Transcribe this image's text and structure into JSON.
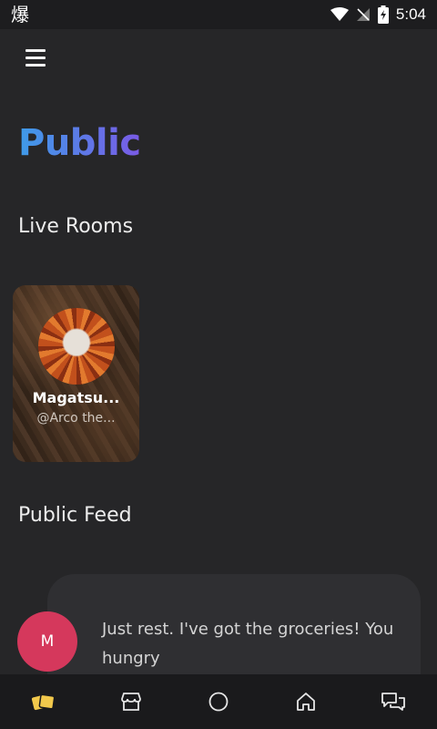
{
  "status_bar": {
    "left_glyph": "爆",
    "time": "5:04",
    "icons": [
      "wifi-icon",
      "no-signal-icon",
      "battery-charging-icon"
    ]
  },
  "header": {
    "menu_icon": "hamburger-menu-icon",
    "title": "Public",
    "title_gradient": [
      "#3e9be8",
      "#7a5ae6"
    ]
  },
  "live_rooms": {
    "heading": "Live Rooms",
    "rooms": [
      {
        "name": "Magatsu...",
        "handle": "@Arco the..."
      }
    ]
  },
  "public_feed": {
    "heading": "Public Feed",
    "posts": [
      {
        "avatar_letter": "M",
        "avatar_color": "#d5385c",
        "text": "Just rest. I've got the groceries! You hungry"
      }
    ]
  },
  "bottom_nav": {
    "items": [
      "cards-icon",
      "store-icon",
      "circle-icon",
      "home-icon",
      "chat-icon"
    ],
    "active_color": "#f2c94c"
  }
}
